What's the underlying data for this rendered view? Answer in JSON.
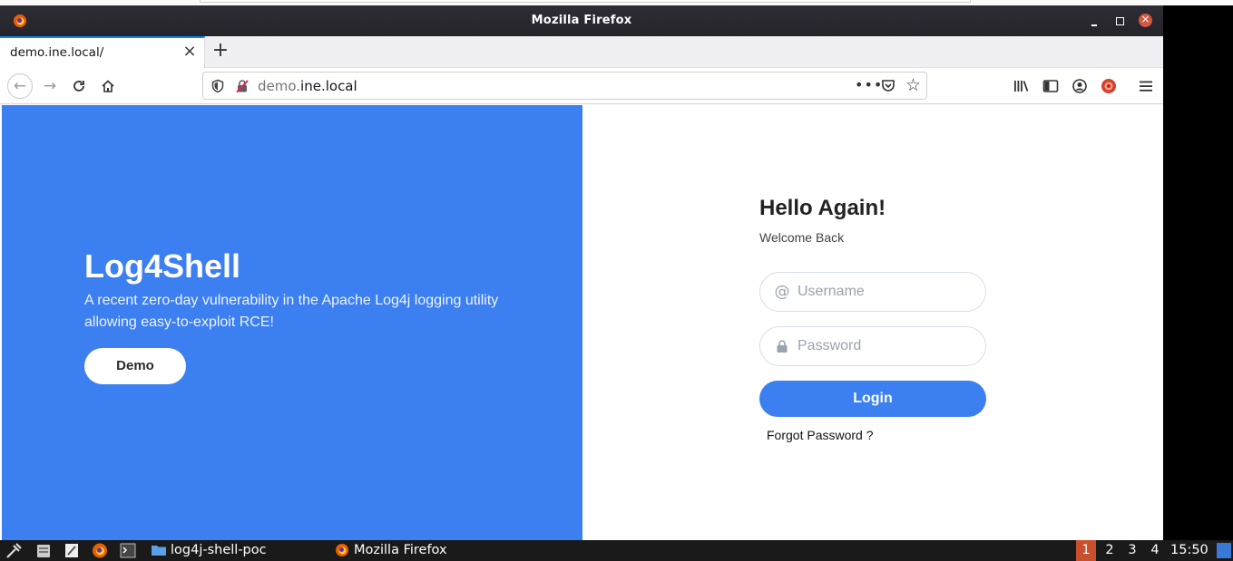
{
  "window": {
    "title": "Mozilla Firefox"
  },
  "browser": {
    "tab_title": "demo.ine.local/",
    "url_prefix": "demo.",
    "url_domain": "ine.local"
  },
  "hero": {
    "title": "Log4Shell",
    "description": "A recent zero-day vulnerability in the Apache Log4j logging utility allowing easy-to-exploit RCE!",
    "demo_button": "Demo",
    "background_color": "#3b7ff0"
  },
  "login": {
    "greeting": "Hello Again!",
    "subtitle": "Welcome Back",
    "username_placeholder": "Username",
    "password_placeholder": "Password",
    "login_button": "Login",
    "forgot_link": "Forgot Password ?"
  },
  "taskbar": {
    "tasks": [
      {
        "label": "log4j-shell-poc",
        "icon": "folder-icon"
      },
      {
        "label": "Mozilla Firefox",
        "icon": "firefox-icon"
      }
    ],
    "workspaces": [
      "1",
      "2",
      "3",
      "4"
    ],
    "active_workspace": "1",
    "clock": "15:50"
  }
}
